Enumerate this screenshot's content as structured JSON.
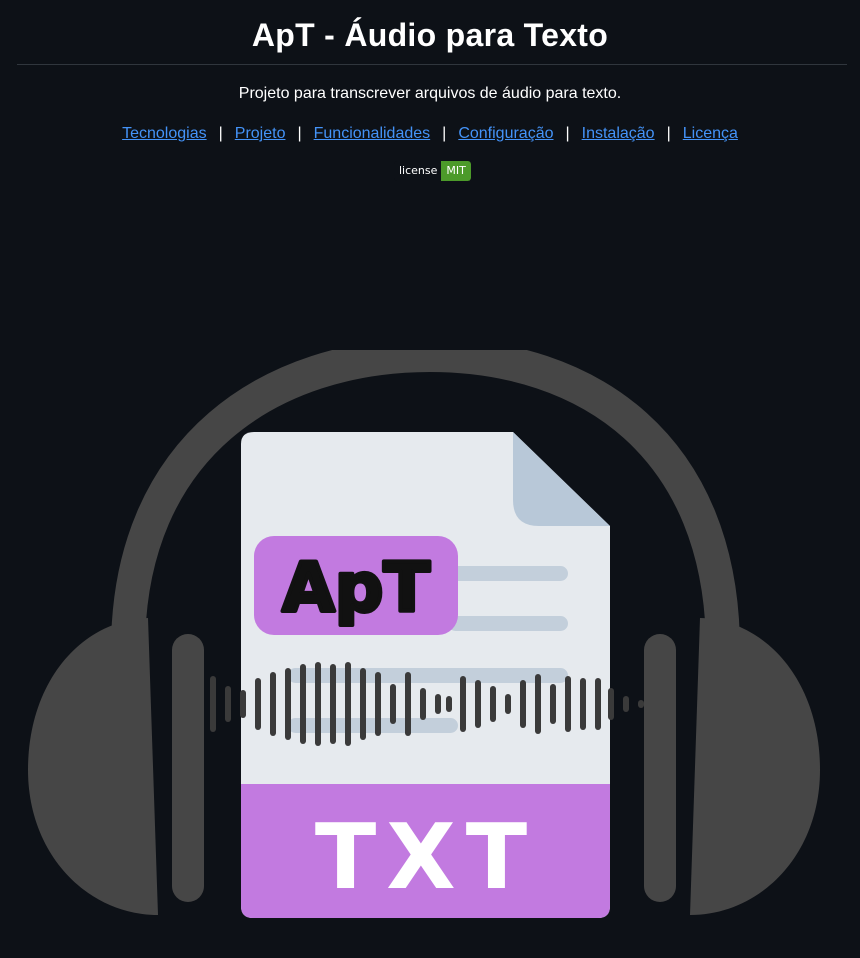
{
  "header": {
    "title": "ApT - Áudio para Texto"
  },
  "description": "Projeto para transcrever arquivos de áudio para texto.",
  "nav": {
    "links": [
      {
        "label": "Tecnologias"
      },
      {
        "label": "Projeto"
      },
      {
        "label": "Funcionalidades"
      },
      {
        "label": "Configuração"
      },
      {
        "label": "Instalação"
      },
      {
        "label": "Licença"
      }
    ],
    "separator": "|"
  },
  "badge": {
    "label": "license",
    "value": "MIT",
    "value_color": "#4c9a2a"
  },
  "logo": {
    "badge_text": "ApT",
    "file_type": "TXT",
    "colors": {
      "headphones": "#464646",
      "document": "#e6eaee",
      "document_fold": "#b8c8d8",
      "accent": "#c27ae0",
      "waveform": "#3a3a3a"
    },
    "icon": "headphones-document-icon"
  },
  "theme": {
    "background": "#0d1117",
    "link": "#4493f8",
    "text": "#ffffff",
    "rule": "#30363d"
  }
}
